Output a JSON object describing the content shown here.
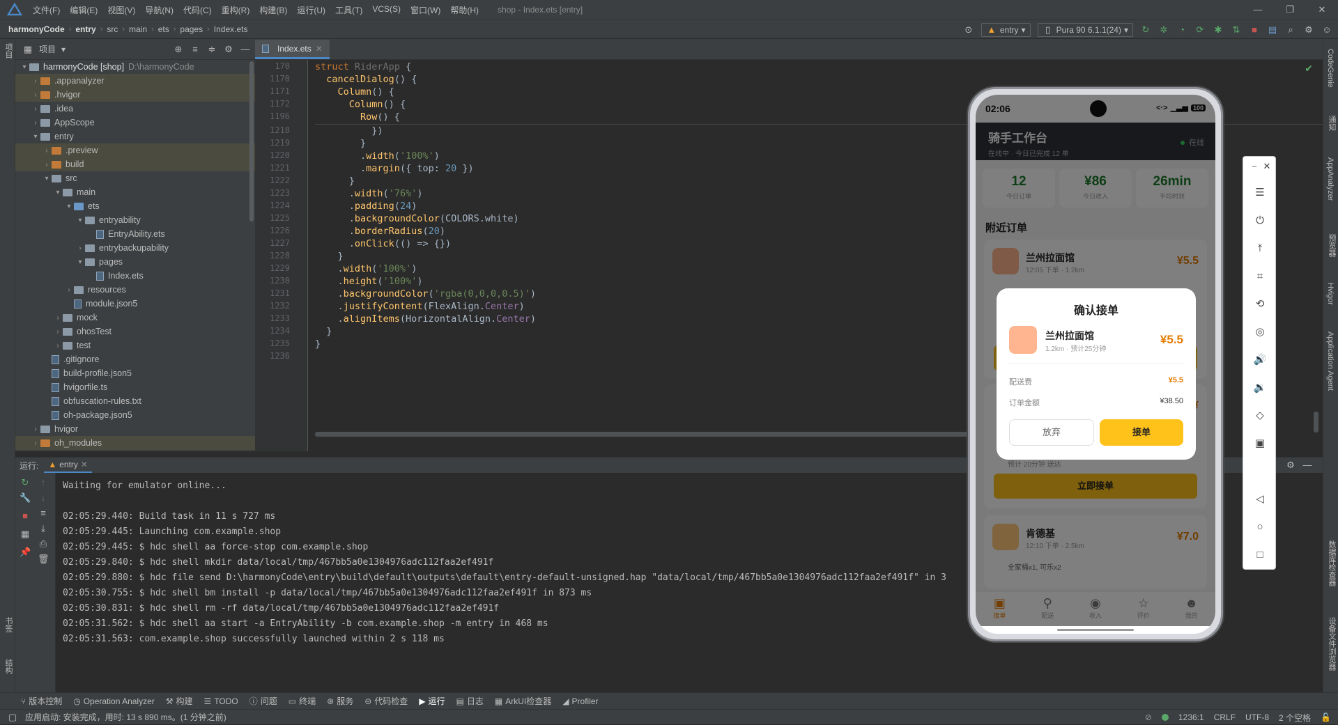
{
  "menu": {
    "items": [
      "文件(F)",
      "编辑(E)",
      "视图(V)",
      "导航(N)",
      "代码(C)",
      "重构(R)",
      "构建(B)",
      "运行(U)",
      "工具(T)",
      "VCS(S)",
      "窗口(W)",
      "帮助(H)"
    ],
    "window_title": "shop - Index.ets [entry]"
  },
  "breadcrumb": [
    "harmonyCode",
    "entry",
    "src",
    "main",
    "ets",
    "pages",
    "Index.ets"
  ],
  "toolbar": {
    "run_config": "entry",
    "device": "Pura 90 6.1.1(24)"
  },
  "project_panel": {
    "title": "项目",
    "tree": [
      {
        "indent": 0,
        "arrow": "v",
        "icon": "folder",
        "label": "harmonyCode [shop]",
        "extra": "D:\\harmonyCode",
        "sel": false
      },
      {
        "indent": 1,
        "arrow": ">",
        "icon": "folder-o",
        "label": ".appanalyzer",
        "sel": true
      },
      {
        "indent": 1,
        "arrow": ">",
        "icon": "folder-o",
        "label": ".hvigor",
        "sel": true
      },
      {
        "indent": 1,
        "arrow": ">",
        "icon": "folder",
        "label": ".idea",
        "sel": false
      },
      {
        "indent": 1,
        "arrow": ">",
        "icon": "folder",
        "label": "AppScope",
        "sel": false
      },
      {
        "indent": 1,
        "arrow": "v",
        "icon": "folder",
        "label": "entry",
        "sel": false
      },
      {
        "indent": 2,
        "arrow": ">",
        "icon": "folder-o",
        "label": ".preview",
        "sel": true
      },
      {
        "indent": 2,
        "arrow": ">",
        "icon": "folder-o",
        "label": "build",
        "sel": true
      },
      {
        "indent": 2,
        "arrow": "v",
        "icon": "folder",
        "label": "src",
        "sel": false
      },
      {
        "indent": 3,
        "arrow": "v",
        "icon": "folder",
        "label": "main",
        "sel": false
      },
      {
        "indent": 4,
        "arrow": "v",
        "icon": "folder-b",
        "label": "ets",
        "sel": false
      },
      {
        "indent": 5,
        "arrow": "v",
        "icon": "folder",
        "label": "entryability",
        "sel": false
      },
      {
        "indent": 6,
        "arrow": "",
        "icon": "file",
        "label": "EntryAbility.ets",
        "sel": false
      },
      {
        "indent": 5,
        "arrow": ">",
        "icon": "folder",
        "label": "entrybackupability",
        "sel": false
      },
      {
        "indent": 5,
        "arrow": "v",
        "icon": "folder",
        "label": "pages",
        "sel": false
      },
      {
        "indent": 6,
        "arrow": "",
        "icon": "file",
        "label": "Index.ets",
        "sel": false
      },
      {
        "indent": 4,
        "arrow": ">",
        "icon": "folder",
        "label": "resources",
        "sel": false
      },
      {
        "indent": 4,
        "arrow": "",
        "icon": "file",
        "label": "module.json5",
        "sel": false
      },
      {
        "indent": 3,
        "arrow": ">",
        "icon": "folder",
        "label": "mock",
        "sel": false
      },
      {
        "indent": 3,
        "arrow": ">",
        "icon": "folder",
        "label": "ohosTest",
        "sel": false
      },
      {
        "indent": 3,
        "arrow": ">",
        "icon": "folder",
        "label": "test",
        "sel": false
      },
      {
        "indent": 2,
        "arrow": "",
        "icon": "file",
        "label": ".gitignore",
        "sel": false
      },
      {
        "indent": 2,
        "arrow": "",
        "icon": "file",
        "label": "build-profile.json5",
        "sel": false
      },
      {
        "indent": 2,
        "arrow": "",
        "icon": "file",
        "label": "hvigorfile.ts",
        "sel": false
      },
      {
        "indent": 2,
        "arrow": "",
        "icon": "file",
        "label": "obfuscation-rules.txt",
        "sel": false
      },
      {
        "indent": 2,
        "arrow": "",
        "icon": "file",
        "label": "oh-package.json5",
        "sel": false
      },
      {
        "indent": 1,
        "arrow": ">",
        "icon": "folder",
        "label": "hvigor",
        "sel": false
      },
      {
        "indent": 1,
        "arrow": ">",
        "icon": "folder-o",
        "label": "oh_modules",
        "sel": true
      }
    ]
  },
  "editor": {
    "tab": "Index.ets",
    "sticky": [
      {
        "ln": "170",
        "html": "<span class=\"kw\">struct</span> <span class=\"gy\">RiderApp</span> {"
      },
      {
        "ln": "1170",
        "html": "  <span class=\"fn\">cancelDialog</span>() {"
      },
      {
        "ln": "1171",
        "html": "    <span class=\"fn\">Column</span>() {"
      },
      {
        "ln": "1172",
        "html": "      <span class=\"fn\">Column</span>() {"
      },
      {
        "ln": "1196",
        "html": "        <span class=\"fn\">Row</span>() {"
      }
    ],
    "lines": [
      {
        "ln": "1218",
        "html": "          })"
      },
      {
        "ln": "1219",
        "html": "        }"
      },
      {
        "ln": "1220",
        "html": "        .<span class=\"fn\">width</span>(<span class=\"st\">'100%'</span>)"
      },
      {
        "ln": "1221",
        "html": "        .<span class=\"fn\">margin</span>({ top: <span class=\"nu\">20</span> })"
      },
      {
        "ln": "1222",
        "html": "      }"
      },
      {
        "ln": "1223",
        "html": "      .<span class=\"fn\">width</span>(<span class=\"st\">'76%'</span>)"
      },
      {
        "ln": "1224",
        "html": "      .<span class=\"fn\">padding</span>(<span class=\"nu\">24</span>)"
      },
      {
        "ln": "1225",
        "html": "      .<span class=\"fn\">backgroundColor</span>(COLORS.white)"
      },
      {
        "ln": "1226",
        "html": "      .<span class=\"fn\">borderRadius</span>(<span class=\"nu\">20</span>)"
      },
      {
        "ln": "1227",
        "html": "      .<span class=\"fn\">onClick</span>(() => {})"
      },
      {
        "ln": "1228",
        "html": "    }"
      },
      {
        "ln": "1229",
        "html": "    .<span class=\"fn\">width</span>(<span class=\"st\">'100%'</span>)"
      },
      {
        "ln": "1230",
        "html": "    .<span class=\"fn\">height</span>(<span class=\"st\">'100%'</span>)"
      },
      {
        "ln": "1231",
        "html": "    .<span class=\"fn\">backgroundColor</span>(<span class=\"st\">'rgba(0,0,0,0.5)'</span>)"
      },
      {
        "ln": "1232",
        "html": "    .<span class=\"fn\">justifyContent</span>(FlexAlign.<span class=\"pm\">Center</span>)"
      },
      {
        "ln": "1233",
        "html": "    .<span class=\"fn\">alignItems</span>(HorizontalAlign.<span class=\"pm\">Center</span>)"
      },
      {
        "ln": "1234",
        "html": "  }"
      },
      {
        "ln": "1235",
        "html": "}"
      },
      {
        "ln": "1236",
        "html": ""
      }
    ]
  },
  "run_panel": {
    "label": "运行:",
    "tab": "entry",
    "console": [
      "Waiting for emulator online...",
      "",
      "02:05:29.440: Build task in 11 s 727 ms",
      "02:05:29.445: Launching com.example.shop",
      "02:05:29.445: $ hdc shell aa force-stop com.example.shop",
      "02:05:29.840: $ hdc shell mkdir data/local/tmp/467bb5a0e1304976adc112faa2ef491f",
      "02:05:29.880: $ hdc file send D:\\harmonyCode\\entry\\build\\default\\outputs\\default\\entry-default-unsigned.hap \"data/local/tmp/467bb5a0e1304976adc112faa2ef491f\" in 3",
      "02:05:30.755: $ hdc shell bm install -p data/local/tmp/467bb5a0e1304976adc112faa2ef491f in 873 ms",
      "02:05:30.831: $ hdc shell rm -rf data/local/tmp/467bb5a0e1304976adc112faa2ef491f",
      "02:05:31.562: $ hdc shell aa start -a EntryAbility -b com.example.shop -m entry in 468 ms",
      "02:05:31.563: com.example.shop successfully launched within 2 s 118 ms"
    ]
  },
  "bottom_tools": [
    "版本控制",
    "Operation Analyzer",
    "构建",
    "TODO",
    "问题",
    "终端",
    "服务",
    "代码检查",
    "运行",
    "日志",
    "ArkUI检查器",
    "Profiler"
  ],
  "status": {
    "left": "应用启动: 安装完成，用时: 13 s 890 ms。(1 分钟之前)",
    "position": "1236:1",
    "line_sep": "CRLF",
    "encoding": "UTF-8",
    "indent": "2 个空格"
  },
  "left_stripe": [
    "项目",
    "书签",
    "结构"
  ],
  "right_stripe": [
    "CodeGenie",
    "通知",
    "AppAnalyzer",
    "预览器",
    "Hvigor",
    "Application Agent",
    "数据库检查器",
    "设备文件浏览器"
  ],
  "phone": {
    "time": "02:06",
    "battery": "100",
    "header_title": "骑手工作台",
    "header_sub": "在线中 · 今日已完成 12 单",
    "online": "在线",
    "stats": [
      {
        "value": "12",
        "label": "今日订单"
      },
      {
        "value": "¥86",
        "label": "今日收入"
      },
      {
        "value": "26min",
        "label": "平均时效"
      }
    ],
    "nearby_title": "附近订单",
    "orders": [
      {
        "name": "兰州拉面馆",
        "meta": "12:05 下单 · 1.2km",
        "price": "¥5.5"
      },
      {
        "name": "",
        "meta": "",
        "price": "¥"
      },
      {
        "name": "肯德基",
        "meta": "12:10 下单 · 2.5km",
        "price": "¥7.0"
      }
    ],
    "order2_eta": "预计 20分钟 送达",
    "grab_label": "立即接单",
    "order3_items": "全家桶x1, 可乐x2",
    "nav": [
      "接单",
      "配送",
      "收入",
      "评价",
      "我的"
    ],
    "dialog": {
      "title": "确认接单",
      "shop": "兰州拉面馆",
      "meta": "1.2km · 预计25分钟",
      "price": "¥5.5",
      "fee_label": "配送费",
      "fee_value": "¥5.5",
      "amount_label": "订单金额",
      "amount_value": "¥38.50",
      "cancel": "放弃",
      "accept": "接单"
    }
  },
  "colors": {
    "accent": "#4a88c7",
    "phone_primary": "#ffc21a",
    "price": "#e57a00",
    "stat": "#1b7a2a"
  }
}
